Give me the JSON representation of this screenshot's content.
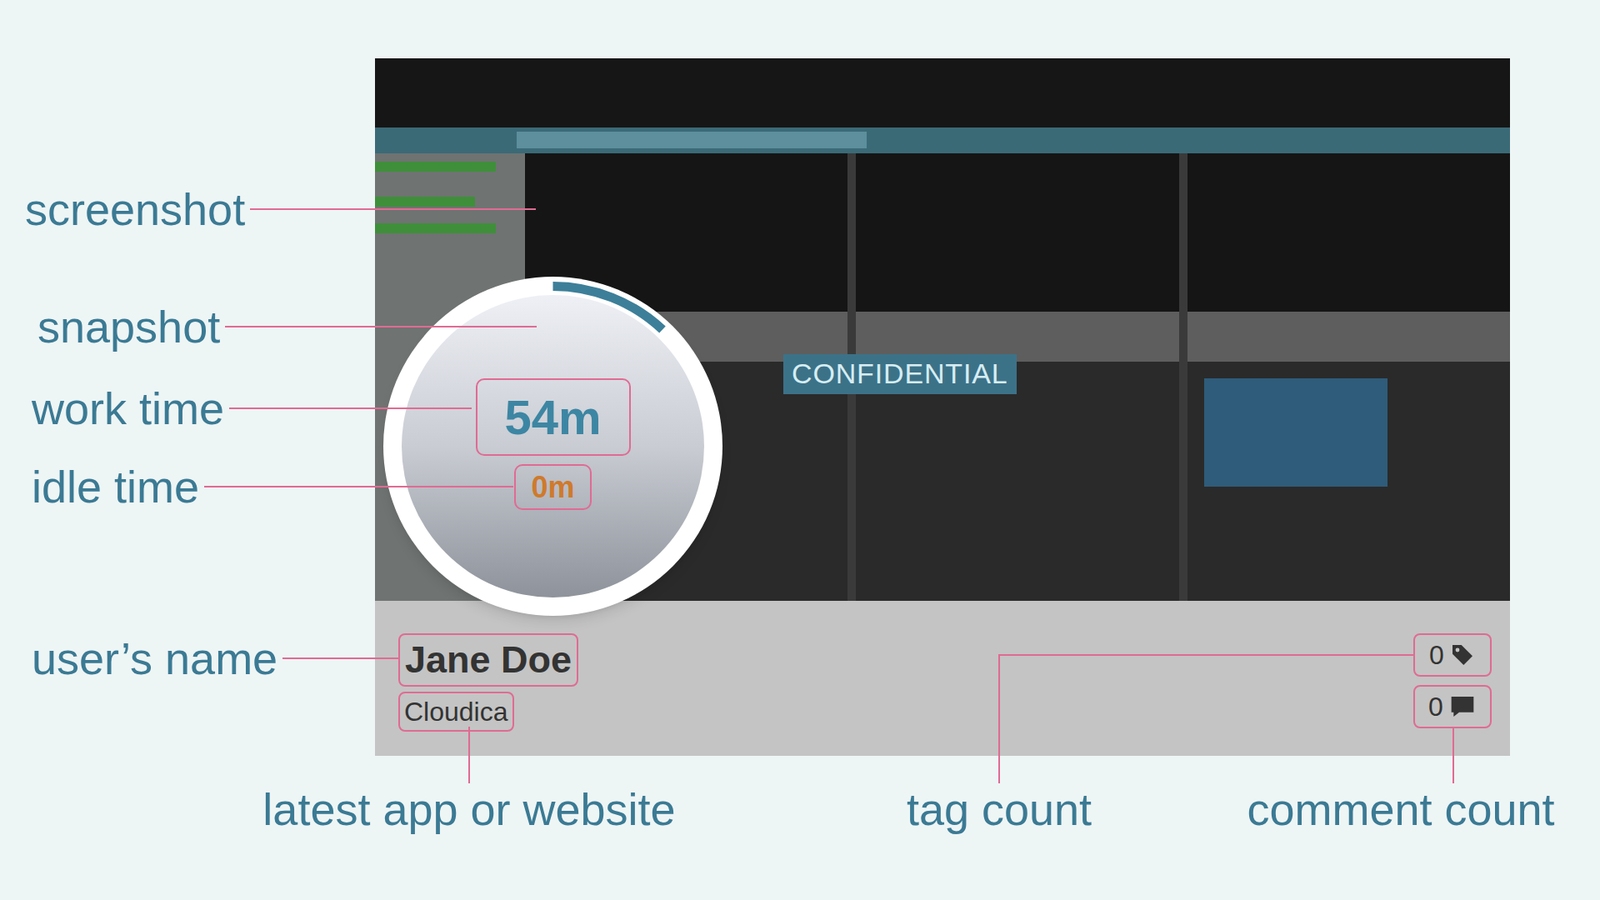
{
  "annotations": [
    {
      "label": "screenshot"
    },
    {
      "label": "snapshot"
    },
    {
      "label": "work time"
    },
    {
      "label": "idle time"
    },
    {
      "label": "user’s name"
    },
    {
      "label": "latest app or website"
    },
    {
      "label": "tag count"
    },
    {
      "label": "comment count"
    }
  ],
  "card": {
    "screenshot": {
      "watermark": "CONFIDENTIAL"
    },
    "snapshot": {
      "level": 0.12
    },
    "work_time": "54m",
    "idle_time": "0m",
    "user_name": "Jane Doe",
    "latest_app": "Cloudica",
    "tag_count": "0",
    "comment_count": "0"
  }
}
